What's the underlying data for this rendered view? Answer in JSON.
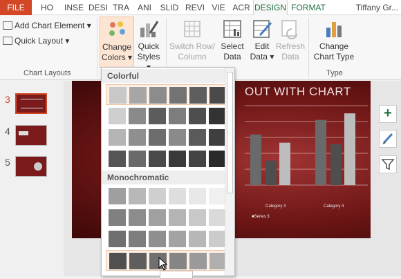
{
  "tabs": [
    "FILE",
    "HO",
    "INSE",
    "DESI",
    "TRA",
    "ANI",
    "SLID",
    "REVI",
    "VIE",
    "ACR",
    "DESIGN",
    "FORMAT"
  ],
  "user": "Tiffany Gr...",
  "ribbon": {
    "add_chart_element": "Add Chart Element",
    "quick_layout": "Quick Layout",
    "chart_layouts_label": "Chart Layouts",
    "change_colors": [
      "Change",
      "Colors"
    ],
    "quick_styles": [
      "Quick",
      "Styles"
    ],
    "switch_row_column": [
      "Switch Row/",
      "Column"
    ],
    "select_data": [
      "Select",
      "Data"
    ],
    "edit_data": [
      "Edit",
      "Data"
    ],
    "refresh_data": [
      "Refresh",
      "Data"
    ],
    "change_chart_type": [
      "Change",
      "Chart Type"
    ],
    "type_label": "Type",
    "dropdown_arrow": "▾"
  },
  "slides": {
    "numbers": [
      "3",
      "4",
      "5"
    ],
    "current": "3"
  },
  "slide": {
    "title": "OUT WITH CHART",
    "category3": "Category 3",
    "category4": "Category 4",
    "legend": "Series 3"
  },
  "side_buttons": {
    "add": "+",
    "style": "brush-icon",
    "filter": "filter-icon"
  },
  "dropdown": {
    "colorful_header": "Colorful",
    "monochromatic_header": "Monochromatic",
    "colorful_rows": [
      [
        "#c8c8c8",
        "#a6a6a6",
        "#8c8c8c",
        "#737373",
        "#5e5e5e",
        "#4a4a4a"
      ],
      [
        "#cfcfcf",
        "#8a8a8a",
        "#5c5c5c",
        "#7d7d7d",
        "#4e4e4e",
        "#333333"
      ],
      [
        "#b5b5b5",
        "#8f8f8f",
        "#6d6d6d",
        "#8a8a8a",
        "#5a5a5a",
        "#3f3f3f"
      ],
      [
        "#555555",
        "#6a6a6a",
        "#4a4a4a",
        "#3a3a3a",
        "#444444",
        "#2a2a2a"
      ]
    ],
    "mono_rows": [
      [
        "#9f9f9f",
        "#b8b8b8",
        "#cfcfcf",
        "#dedede",
        "#e8e8e8",
        "#f0f0f0"
      ],
      [
        "#808080",
        "#8c8c8c",
        "#a0a0a0",
        "#b4b4b4",
        "#c8c8c8",
        "#dadada"
      ],
      [
        "#6f6f6f",
        "#7d7d7d",
        "#8f8f8f",
        "#a3a3a3",
        "#b7b7b7",
        "#cbcbcb"
      ],
      [
        "#505050",
        "#5e5e5e",
        "#707070",
        "#858585",
        "#9a9a9a",
        "#afafaf"
      ]
    ],
    "accent": "#f2c09c"
  },
  "chart_bars": [
    {
      "category": "Category 3",
      "series": "dark",
      "value": 0.62
    },
    {
      "category": "Category 3",
      "series": "mid",
      "value": 0.3
    },
    {
      "category": "Category 3",
      "series": "light",
      "value": 0.52
    },
    {
      "category": "Category 4",
      "series": "dark",
      "value": 0.8
    },
    {
      "category": "Category 4",
      "series": "mid",
      "value": 0.5
    },
    {
      "category": "Category 4",
      "series": "light",
      "value": 0.88
    }
  ]
}
